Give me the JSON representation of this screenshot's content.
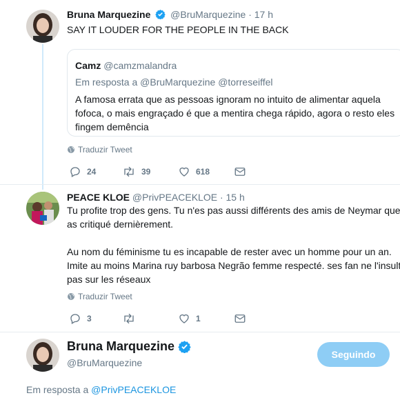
{
  "tweet1": {
    "name": "Bruna Marquezine",
    "handle": "@BruMarquezine",
    "time": "· 17 h",
    "text": "SAY IT LOUDER FOR THE PEOPLE IN THE BACK",
    "quote": {
      "name": "Camz",
      "handle": "@camzmalandra",
      "reply_prefix": "Em resposta a",
      "reply_handles": "@BruMarquezine @torreseiffel",
      "lines": [
        "A famosa errata que as pessoas ignoram no intuito de alimentar aquela",
        "fofoca, o mais engraçado é que a mentira chega rápido, agora o resto eles",
        "fingem demência"
      ]
    },
    "translate": "Traduzir Tweet",
    "replies": "24",
    "retweets": "39",
    "likes": "618"
  },
  "tweet2": {
    "name": "PEACE KLOE",
    "handle": "@PrivPEACEKLOE",
    "time": "· 15 h",
    "lines": [
      "Tu profite trop des gens. Tu n'es pas aussi différents des amis de Neymar que tu",
      "as critiqué dernièrement.",
      "",
      "Au nom du féminisme tu es incapable de rester avec un homme pour un an.",
      "Imite au moins Marina ruy barbosa Negrão femme respecté. ses fan ne l'insultent",
      "pas sur les réseaux"
    ],
    "translate": "Traduzir Tweet",
    "replies": "3",
    "retweets": "",
    "likes": "1"
  },
  "tweet3": {
    "name": "Bruna Marquezine",
    "handle": "@BruMarquezine",
    "follow_label": "Seguindo",
    "reply_prefix": "Em resposta a",
    "reply_handle": "@PrivPEACEKLOE"
  },
  "colors": {
    "accent": "#1b95e0",
    "verified": "#1da1f2",
    "follow_button": "#8ecdf5",
    "muted": "#657786"
  },
  "icons": [
    "verified-icon",
    "globe-icon",
    "reply-icon",
    "retweet-icon",
    "like-icon",
    "dm-icon"
  ]
}
